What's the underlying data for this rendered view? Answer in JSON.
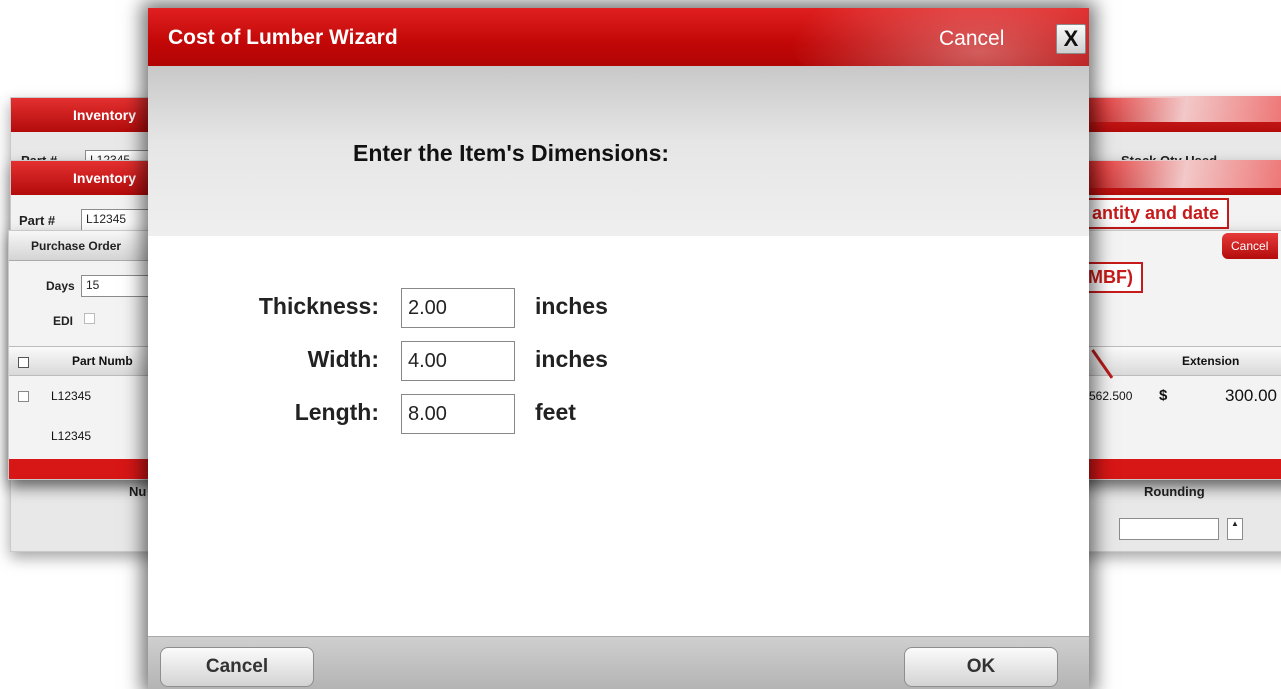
{
  "dialog": {
    "title": "Cost of Lumber Wizard",
    "header_cancel": "Cancel",
    "close_glyph": "X",
    "heading": "Enter the Item's Dimensions:",
    "fields": [
      {
        "label": "Thickness:",
        "value": "2.00",
        "unit": "inches"
      },
      {
        "label": "Width:",
        "value": "4.00",
        "unit": "inches"
      },
      {
        "label": "Length:",
        "value": "8.00",
        "unit": "feet"
      }
    ],
    "footer": {
      "cancel_label": "Cancel",
      "ok_label": "OK"
    }
  },
  "background": {
    "win1": {
      "title": "Inventory",
      "field_label": "Part #",
      "field_value": "L12345",
      "right_label": "Stock Qty Used",
      "footer_label": "Nu",
      "rounding_label": "Rounding"
    },
    "win2": {
      "title": "Inventory",
      "field_label": "Part #",
      "field_value": "L12345",
      "callout": "antity and date"
    },
    "win3": {
      "title": "Purchase Order",
      "days_label": "Days",
      "days_value": "15",
      "edi_label": "EDI",
      "col_part": "Part Numb",
      "col_extension": "Extension",
      "rows": [
        {
          "part": "L12345",
          "price": "562.500",
          "currency": "$",
          "extension": "300.00"
        },
        {
          "part": "L12345"
        }
      ],
      "callout": "MBF)",
      "cancel_label": "Cancel"
    }
  }
}
